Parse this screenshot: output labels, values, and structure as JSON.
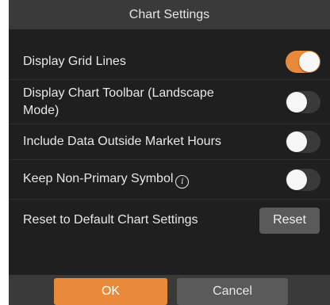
{
  "dialog": {
    "title": "Chart Settings"
  },
  "settings": [
    {
      "label": "Display Grid Lines",
      "enabled": true
    },
    {
      "label": "Display Chart Toolbar (Landscape Mode)",
      "enabled": false
    },
    {
      "label": "Include Data Outside Market Hours",
      "enabled": false
    },
    {
      "label": "Keep Non-Primary Symbol",
      "enabled": false,
      "icon": "info-icon"
    }
  ],
  "reset": {
    "label": "Reset to Default Chart Settings",
    "button_label": "Reset"
  },
  "footer": {
    "ok_label": "OK",
    "cancel_label": "Cancel"
  },
  "colors": {
    "accent": "#e88a3a",
    "background": "#1f1f1f",
    "bar": "#3a3a3a",
    "button": "#5a5a5a"
  }
}
